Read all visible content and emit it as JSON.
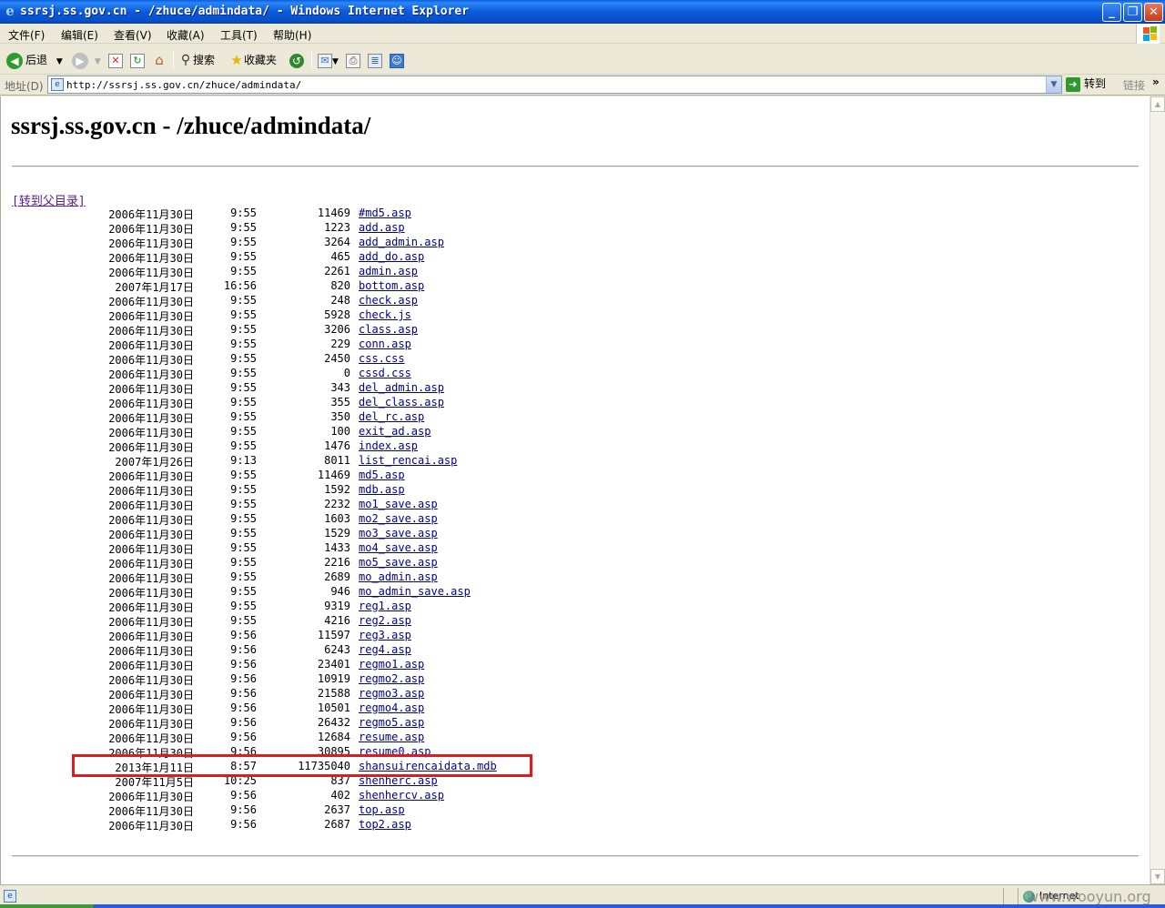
{
  "window": {
    "title": "ssrsj.ss.gov.cn - /zhuce/admindata/ - Windows Internet Explorer"
  },
  "menu": [
    "文件(F)",
    "编辑(E)",
    "查看(V)",
    "收藏(A)",
    "工具(T)",
    "帮助(H)"
  ],
  "toolbar": {
    "back_label": "后退",
    "search_label": "搜索",
    "favorites_label": "收藏夹"
  },
  "address": {
    "label": "地址(D)",
    "url": "http://ssrsj.ss.gov.cn/zhuce/admindata/",
    "go_label": "转到",
    "links_label": "链接"
  },
  "page": {
    "heading": "ssrsj.ss.gov.cn - /zhuce/admindata/",
    "parent_link": "[转到父目录]",
    "files": [
      {
        "date": "2006年11月30日",
        "time": "9:55",
        "size": "11469",
        "name": "#md5.asp"
      },
      {
        "date": "2006年11月30日",
        "time": "9:55",
        "size": "1223",
        "name": "add.asp"
      },
      {
        "date": "2006年11月30日",
        "time": "9:55",
        "size": "3264",
        "name": "add_admin.asp"
      },
      {
        "date": "2006年11月30日",
        "time": "9:55",
        "size": "465",
        "name": "add_do.asp"
      },
      {
        "date": "2006年11月30日",
        "time": "9:55",
        "size": "2261",
        "name": "admin.asp"
      },
      {
        "date": "2007年1月17日",
        "time": "16:56",
        "size": "820",
        "name": "bottom.asp"
      },
      {
        "date": "2006年11月30日",
        "time": "9:55",
        "size": "248",
        "name": "check.asp"
      },
      {
        "date": "2006年11月30日",
        "time": "9:55",
        "size": "5928",
        "name": "check.js"
      },
      {
        "date": "2006年11月30日",
        "time": "9:55",
        "size": "3206",
        "name": "class.asp"
      },
      {
        "date": "2006年11月30日",
        "time": "9:55",
        "size": "229",
        "name": "conn.asp"
      },
      {
        "date": "2006年11月30日",
        "time": "9:55",
        "size": "2450",
        "name": "css.css"
      },
      {
        "date": "2006年11月30日",
        "time": "9:55",
        "size": "0",
        "name": "cssd.css"
      },
      {
        "date": "2006年11月30日",
        "time": "9:55",
        "size": "343",
        "name": "del_admin.asp"
      },
      {
        "date": "2006年11月30日",
        "time": "9:55",
        "size": "355",
        "name": "del_class.asp"
      },
      {
        "date": "2006年11月30日",
        "time": "9:55",
        "size": "350",
        "name": "del_rc.asp"
      },
      {
        "date": "2006年11月30日",
        "time": "9:55",
        "size": "100",
        "name": "exit_ad.asp"
      },
      {
        "date": "2006年11月30日",
        "time": "9:55",
        "size": "1476",
        "name": "index.asp"
      },
      {
        "date": "2007年1月26日",
        "time": "9:13",
        "size": "8011",
        "name": "list_rencai.asp"
      },
      {
        "date": "2006年11月30日",
        "time": "9:55",
        "size": "11469",
        "name": "md5.asp"
      },
      {
        "date": "2006年11月30日",
        "time": "9:55",
        "size": "1592",
        "name": "mdb.asp"
      },
      {
        "date": "2006年11月30日",
        "time": "9:55",
        "size": "2232",
        "name": "mo1_save.asp"
      },
      {
        "date": "2006年11月30日",
        "time": "9:55",
        "size": "1603",
        "name": "mo2_save.asp"
      },
      {
        "date": "2006年11月30日",
        "time": "9:55",
        "size": "1529",
        "name": "mo3_save.asp"
      },
      {
        "date": "2006年11月30日",
        "time": "9:55",
        "size": "1433",
        "name": "mo4_save.asp"
      },
      {
        "date": "2006年11月30日",
        "time": "9:55",
        "size": "2216",
        "name": "mo5_save.asp"
      },
      {
        "date": "2006年11月30日",
        "time": "9:55",
        "size": "2689",
        "name": "mo_admin.asp"
      },
      {
        "date": "2006年11月30日",
        "time": "9:55",
        "size": "946",
        "name": "mo_admin_save.asp"
      },
      {
        "date": "2006年11月30日",
        "time": "9:55",
        "size": "9319",
        "name": "reg1.asp"
      },
      {
        "date": "2006年11月30日",
        "time": "9:55",
        "size": "4216",
        "name": "reg2.asp"
      },
      {
        "date": "2006年11月30日",
        "time": "9:56",
        "size": "11597",
        "name": "reg3.asp"
      },
      {
        "date": "2006年11月30日",
        "time": "9:56",
        "size": "6243",
        "name": "reg4.asp"
      },
      {
        "date": "2006年11月30日",
        "time": "9:56",
        "size": "23401",
        "name": "regmo1.asp"
      },
      {
        "date": "2006年11月30日",
        "time": "9:56",
        "size": "10919",
        "name": "regmo2.asp"
      },
      {
        "date": "2006年11月30日",
        "time": "9:56",
        "size": "21588",
        "name": "regmo3.asp"
      },
      {
        "date": "2006年11月30日",
        "time": "9:56",
        "size": "10501",
        "name": "regmo4.asp"
      },
      {
        "date": "2006年11月30日",
        "time": "9:56",
        "size": "26432",
        "name": "regmo5.asp"
      },
      {
        "date": "2006年11月30日",
        "time": "9:56",
        "size": "12684",
        "name": "resume.asp"
      },
      {
        "date": "2006年11月30日",
        "time": "9:56",
        "size": "30895",
        "name": "resume0.asp"
      },
      {
        "date": "2013年1月11日",
        "time": "8:57",
        "size": "11735040",
        "name": "shansuirencaidata.mdb"
      },
      {
        "date": "2007年11月5日",
        "time": "10:25",
        "size": "837",
        "name": "shenherc.asp"
      },
      {
        "date": "2006年11月30日",
        "time": "9:56",
        "size": "402",
        "name": "shenhercv.asp"
      },
      {
        "date": "2006年11月30日",
        "time": "9:56",
        "size": "2637",
        "name": "top.asp"
      },
      {
        "date": "2006年11月30日",
        "time": "9:56",
        "size": "2687",
        "name": "top2.asp"
      }
    ],
    "highlight_color": "#e01b1b"
  },
  "status": {
    "zone": "Internet"
  },
  "watermark": "www.wooyun.org"
}
